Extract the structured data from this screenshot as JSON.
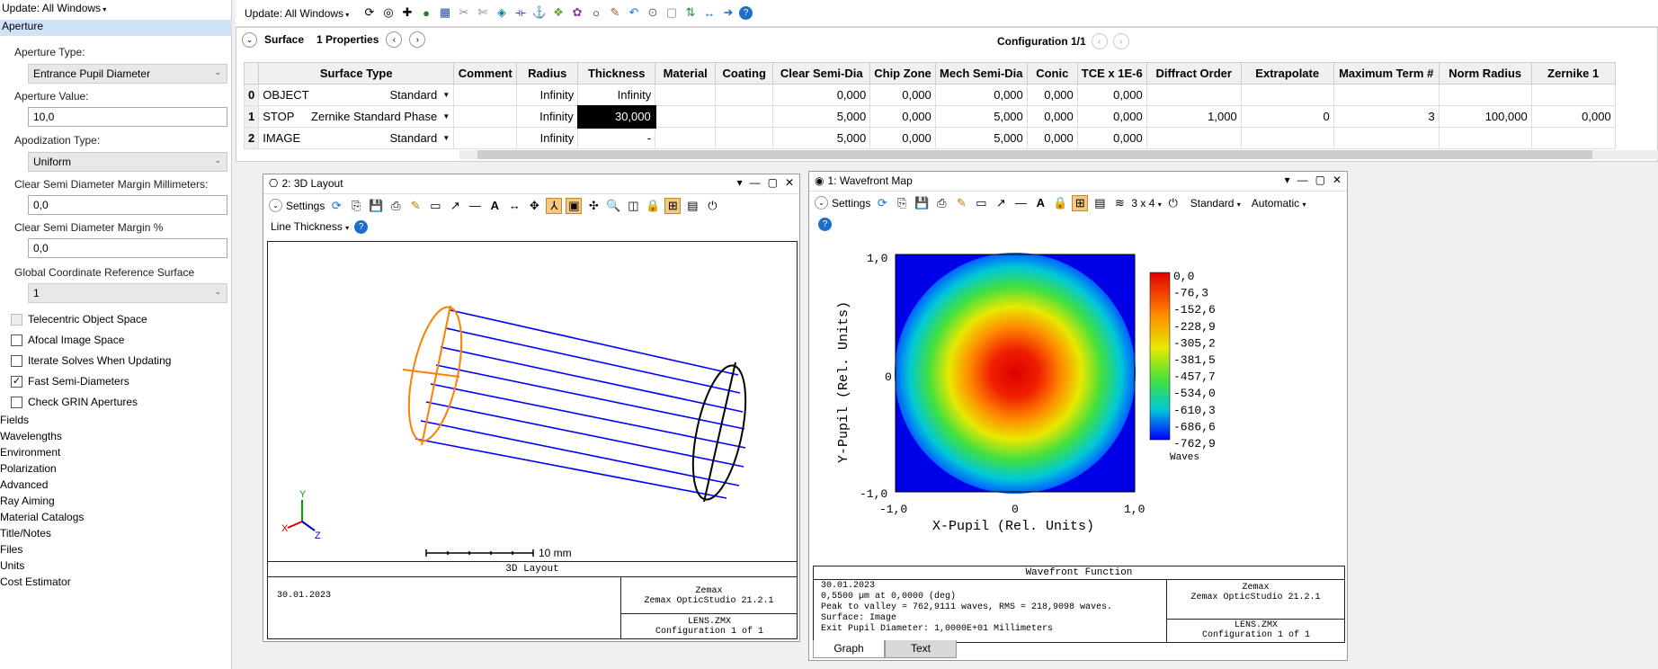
{
  "left_panel": {
    "update_label": "Update: All Windows",
    "section_title": "Aperture",
    "aperture_type_label": "Aperture Type:",
    "aperture_type_value": "Entrance Pupil Diameter",
    "aperture_value_label": "Aperture Value:",
    "aperture_value": "10,0",
    "apodization_label": "Apodization Type:",
    "apodization_value": "Uniform",
    "margin_mm_label": "Clear Semi Diameter Margin Millimeters:",
    "margin_mm_value": "0,0",
    "margin_pct_label": "Clear Semi Diameter Margin %",
    "margin_pct_value": "0,0",
    "global_ref_label": "Global Coordinate Reference Surface",
    "global_ref_value": "1",
    "checkboxes": [
      {
        "label": "Telecentric Object Space",
        "checked": false,
        "disabled": true
      },
      {
        "label": "Afocal Image Space",
        "checked": false,
        "disabled": false
      },
      {
        "label": "Iterate Solves When Updating",
        "checked": false,
        "disabled": false
      },
      {
        "label": "Fast Semi-Diameters",
        "checked": true,
        "disabled": false
      },
      {
        "label": "Check GRIN Apertures",
        "checked": false,
        "disabled": false
      }
    ],
    "categories": [
      "Fields",
      "Wavelengths",
      "Environment",
      "Polarization",
      "Advanced",
      "Ray Aiming",
      "Material Catalogs",
      "Title/Notes",
      "Files",
      "Units",
      "Cost Estimator"
    ]
  },
  "toolbar": {
    "update_label": "Update: All Windows"
  },
  "editor": {
    "surface_label": "Surface",
    "properties_label": "1 Properties",
    "configuration_label": "Configuration 1/1",
    "columns": [
      "Surface Type",
      "Comment",
      "Radius",
      "Thickness",
      "Material",
      "Coating",
      "Clear Semi-Dia",
      "Chip Zone",
      "Mech Semi-Dia",
      "Conic",
      "TCE x 1E-6",
      "Diffract Order",
      "Extrapolate",
      "Maximum Term #",
      "Norm Radius",
      "Zernike 1"
    ],
    "rows": [
      {
        "num": "0",
        "name": "OBJECT",
        "type": "Standard",
        "comment": "",
        "radius": "Infinity",
        "thickness": "Infinity",
        "material": "",
        "coating": "",
        "clear": "0,000",
        "chip": "0,000",
        "mech": "0,000",
        "conic": "0,000",
        "tce": "0,000",
        "diffract": "",
        "extrap": "",
        "maxterm": "",
        "normrad": "",
        "zern1": ""
      },
      {
        "num": "1",
        "name": "STOP",
        "type": "Zernike Standard Phase",
        "comment": "",
        "radius": "Infinity",
        "thickness": "30,000",
        "material": "",
        "coating": "",
        "clear": "5,000",
        "chip": "0,000",
        "mech": "5,000",
        "conic": "0,000",
        "tce": "0,000",
        "diffract": "1,000",
        "extrap": "0",
        "maxterm": "3",
        "normrad": "100,000",
        "zern1": "0,000"
      },
      {
        "num": "2",
        "name": "IMAGE",
        "type": "Standard",
        "comment": "",
        "radius": "Infinity",
        "thickness": "-",
        "material": "",
        "coating": "",
        "clear": "5,000",
        "chip": "0,000",
        "mech": "5,000",
        "conic": "0,000",
        "tce": "0,000",
        "diffract": "",
        "extrap": "",
        "maxterm": "",
        "normrad": "",
        "zern1": ""
      }
    ]
  },
  "layout_window": {
    "title": "2: 3D Layout",
    "settings_label": "Settings",
    "line_thickness_label": "Line Thickness",
    "axis_y": "Y",
    "axis_x": "X",
    "axis_z": "Z",
    "scale_label": "10 mm",
    "plot_title": "3D Layout",
    "date": "30.01.2023",
    "company": "Zemax",
    "product": "Zemax OpticStudio 21.2.1",
    "file": "LENS.ZMX",
    "config": "Configuration 1 of 1"
  },
  "wavefront_window": {
    "title": "1: Wavefront Map",
    "settings_label": "Settings",
    "grid_label": "3 x 4",
    "standard_label": "Standard",
    "automatic_label": "Automatic",
    "y_axis_label": "Y-Pupil (Rel. Units)",
    "x_axis_label": "X-Pupil (Rel. Units)",
    "x_ticks": [
      "-1,0",
      "0",
      "1,0"
    ],
    "y_ticks": [
      "1,0",
      "0",
      "-1,0"
    ],
    "colorbar_ticks": [
      "0,0",
      "-76,3",
      "-152,6",
      "-228,9",
      "-305,2",
      "-381,5",
      "-457,7",
      "-534,0",
      "-610,3",
      "-686,6",
      "-762,9"
    ],
    "colorbar_unit": "Waves",
    "plot_title": "Wavefront Function",
    "date": "30.01.2023",
    "info_line1": "0,5500 µm at 0,0000 (deg)",
    "info_line2": "Peak to valley = 762,9111 waves, RMS = 218,9098 waves.",
    "info_line3": "Surface: Image",
    "info_line4": "Exit Pupil Diameter: 1,0000E+01 Millimeters",
    "company": "Zemax",
    "product": "Zemax OpticStudio 21.2.1",
    "file": "LENS.ZMX",
    "config": "Configuration 1 of 1",
    "tab_graph": "Graph",
    "tab_text": "Text"
  },
  "colors": {
    "accent": "#1e6fc9",
    "selection": "#cfe3f7",
    "ray": "#0000ff",
    "surface": "#ff8000"
  }
}
